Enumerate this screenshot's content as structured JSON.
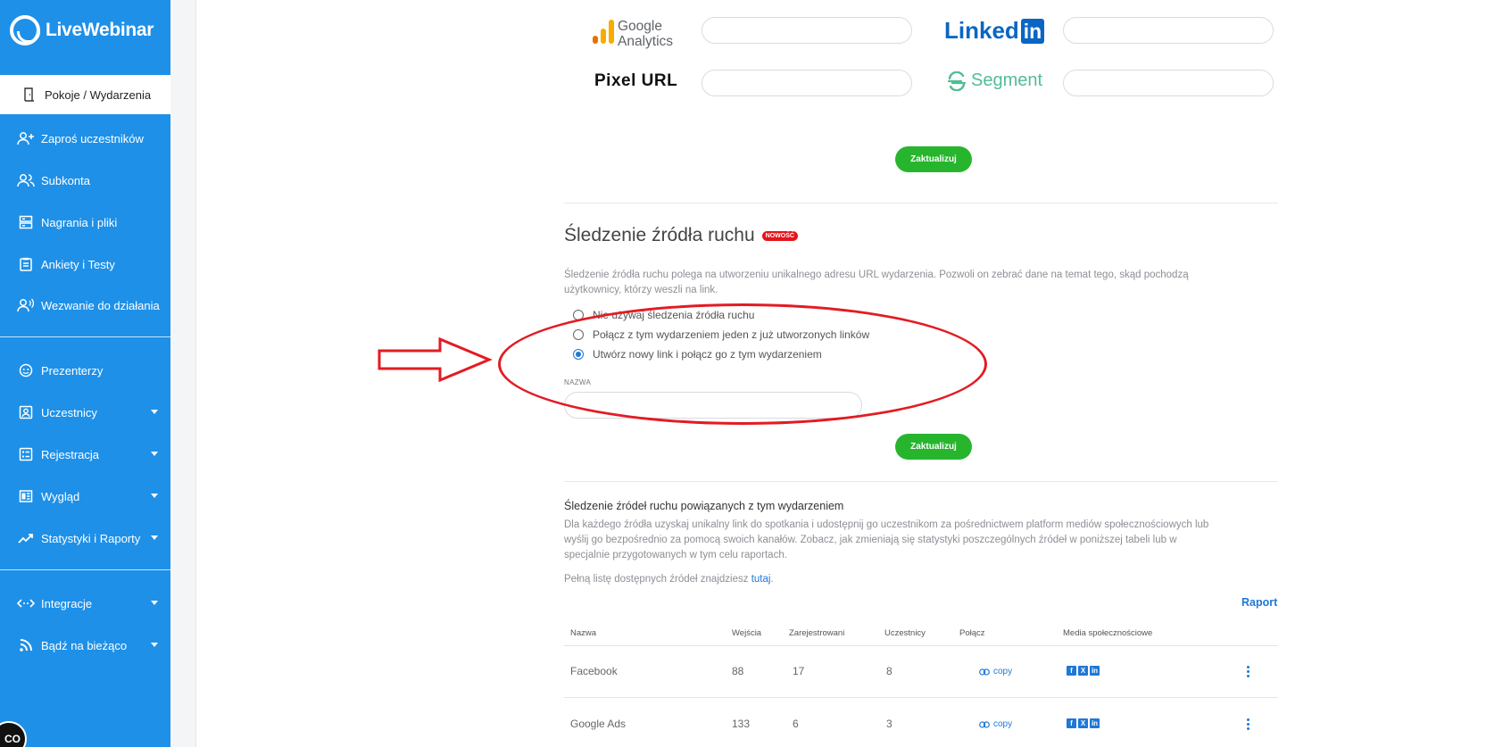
{
  "app": {
    "name": "LiveWebinar"
  },
  "sidebar": {
    "items": [
      {
        "label": "Pokoje / Wydarzenia",
        "icon": "door-icon"
      },
      {
        "label": "Zaproś uczestników",
        "icon": "add-user-icon"
      },
      {
        "label": "Subkonta",
        "icon": "users-icon"
      },
      {
        "label": "Nagrania i pliki",
        "icon": "storage-icon"
      },
      {
        "label": "Ankiety i Testy",
        "icon": "clipboard-icon"
      },
      {
        "label": "Wezwanie do działania",
        "icon": "user-voice-icon"
      },
      {
        "label": "Prezenterzy",
        "icon": "smile-icon"
      },
      {
        "label": "Uczestnicy",
        "icon": "contact-card-icon"
      },
      {
        "label": "Rejestracja",
        "icon": "form-icon"
      },
      {
        "label": "Wygląd",
        "icon": "layout-icon"
      },
      {
        "label": "Statystyki i Raporty",
        "icon": "trend-icon"
      },
      {
        "label": "Integracje",
        "icon": "code-arrows-icon"
      },
      {
        "label": "Bądź na bieżąco",
        "icon": "rss-icon"
      }
    ],
    "chat_label": "CO"
  },
  "integrations": {
    "google_analytics": {
      "line1": "Google",
      "line2": "Analytics"
    },
    "linkedin": {
      "text": "Linked",
      "box": "in"
    },
    "pixel_url": "Pixel URL",
    "segment": "Segment",
    "update_button": "Zaktualizuj"
  },
  "tracking": {
    "title": "Śledzenie źródła ruchu",
    "badge": "NOWOŚĆ",
    "description": "Śledzenie źródła ruchu polega na utworzeniu unikalnego adresu URL wydarzenia. Pozwoli on zebrać dane na temat tego, skąd pochodzą użytkownicy, którzy weszli na link.",
    "options": [
      {
        "label": "Nie używaj śledzenia źródła ruchu",
        "checked": false
      },
      {
        "label": "Połącz z tym wydarzeniem jeden z już utworzonych linków",
        "checked": false
      },
      {
        "label": "Utwórz nowy link i połącz go z tym wydarzeniem",
        "checked": true
      }
    ],
    "name_label": "NAZWA",
    "name_value": "",
    "update_button": "Zaktualizuj"
  },
  "sources": {
    "title": "Śledzenie źródeł ruchu powiązanych z tym wydarzeniem",
    "description": "Dla każdego źródła uzyskaj unikalny link do spotkania i udostępnij go uczestnikom za pośrednictwem platform mediów społecznościowych lub wyślij go bezpośrednio za pomocą swoich kanałów. Zobacz, jak zmieniają się statystyki poszczególnych źródeł w poniższej tabeli lub w specjalnie przygotowanych w tym celu raportach.",
    "full_list_prefix": "Pełną listę dostępnych źródeł znajdziesz ",
    "full_list_link": "tutaj",
    "full_list_suffix": ".",
    "report_link": "Raport",
    "table": {
      "headers": [
        "Nazwa",
        "Wejścia",
        "Zarejestrowani",
        "Uczestnicy",
        "Połącz",
        "Media społecznościowe"
      ],
      "rows": [
        {
          "name": "Facebook",
          "entries": "88",
          "registered": "17",
          "participants": "8",
          "connect": "copy"
        },
        {
          "name": "Google Ads",
          "entries": "133",
          "registered": "6",
          "participants": "3",
          "connect": "copy"
        }
      ]
    }
  },
  "colors": {
    "sidebar": "#1e90e8",
    "primary_link": "#1e78d6",
    "button_green": "#27b52e",
    "annotation_red": "#e31b23",
    "badge_red": "#e5141c"
  }
}
